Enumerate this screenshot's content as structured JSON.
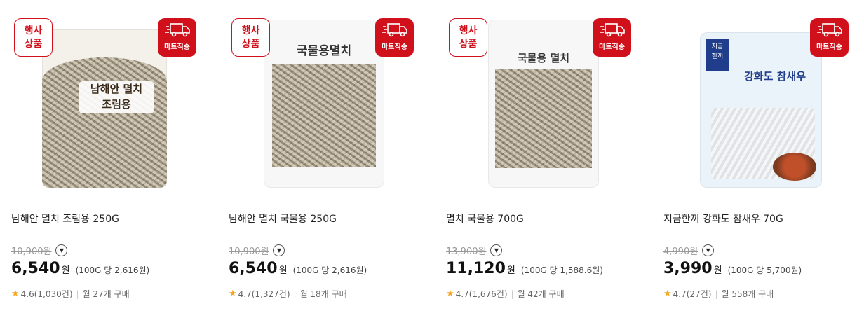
{
  "products": [
    {
      "event_badge": "행사\n상품",
      "mart_badge": "마트직송",
      "package_label": "남해안 멸치\n조림용",
      "name": "남해안 멸치 조림용 250G",
      "original_price": "10,900원",
      "price": "6,540",
      "price_unit": "원",
      "unit_price": "(100G 당 2,616원)",
      "rating": "4.6",
      "review_count": "(1,030건)",
      "monthly_purchases": "월 27개 구매"
    },
    {
      "event_badge": "행사\n상품",
      "mart_badge": "마트직송",
      "package_label": "국물용멸치",
      "name": "남해안 멸치 국물용 250G",
      "original_price": "10,900원",
      "price": "6,540",
      "price_unit": "원",
      "unit_price": "(100G 당 2,616원)",
      "rating": "4.7",
      "review_count": "(1,327건)",
      "monthly_purchases": "월 18개 구매"
    },
    {
      "event_badge": "행사\n상품",
      "mart_badge": "마트직송",
      "package_label": "국물용 멸치",
      "name": "멸치 국물용 700G",
      "original_price": "13,900원",
      "price": "11,120",
      "price_unit": "원",
      "unit_price": "(100G 당 1,588.6원)",
      "rating": "4.7",
      "review_count": "(1,676건)",
      "monthly_purchases": "월 42개 구매"
    },
    {
      "mart_badge": "마트직송",
      "package_brand": "지금\n한끼",
      "package_label": "강화도 참새우",
      "name": "지금한끼 강화도 참새우 70G",
      "original_price": "4,990원",
      "price": "3,990",
      "price_unit": "원",
      "unit_price": "(100G 당 5,700원)",
      "rating": "4.7",
      "review_count": "(27건)",
      "monthly_purchases": "월 558개 구매"
    }
  ],
  "icons": {
    "truck": "truck-icon",
    "star": "star-icon",
    "coupon": "chevron-down-icon"
  },
  "colors": {
    "accent": "#d0101b",
    "star": "#f5a623"
  }
}
